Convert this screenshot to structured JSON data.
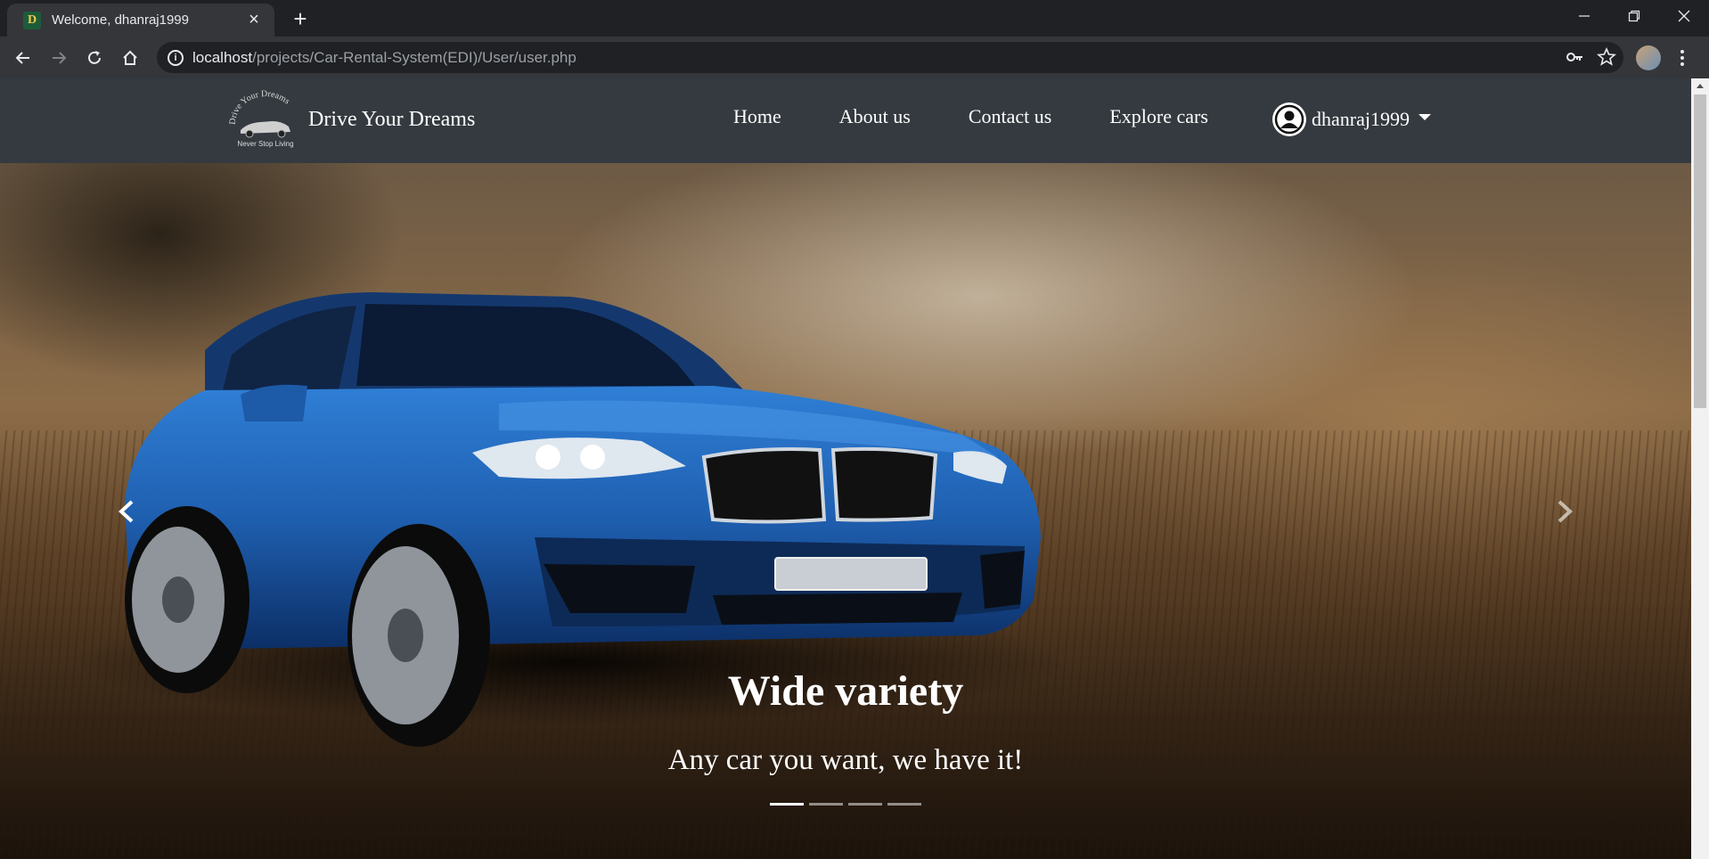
{
  "browser": {
    "tab": {
      "favicon_letter": "D",
      "title": "Welcome, dhanraj1999"
    },
    "url": {
      "host": "localhost",
      "path": "/projects/Car-Rental-System(EDI)/User/user.php"
    },
    "icons": [
      "back-icon",
      "forward-icon",
      "reload-icon",
      "home-icon",
      "info-icon",
      "key-icon",
      "star-icon",
      "menu-icon"
    ]
  },
  "navbar": {
    "logo_text_top": "Drive Your Dreams",
    "logo_text_bottom": "Never Stop Living",
    "brand": "Drive Your Dreams",
    "links": [
      "Home",
      "About us",
      "Contact us",
      "Explore cars"
    ],
    "user": "dhanraj1999"
  },
  "carousel": {
    "caption_title": "Wide variety",
    "caption_text": "Any car you want, we have it!",
    "slide_count": 4,
    "active_index": 0
  },
  "colors": {
    "navbar_bg": "#343a40",
    "chrome_dark": "#202124",
    "chrome_toolbar": "#35363a",
    "car_blue": "#1f5fb0"
  }
}
